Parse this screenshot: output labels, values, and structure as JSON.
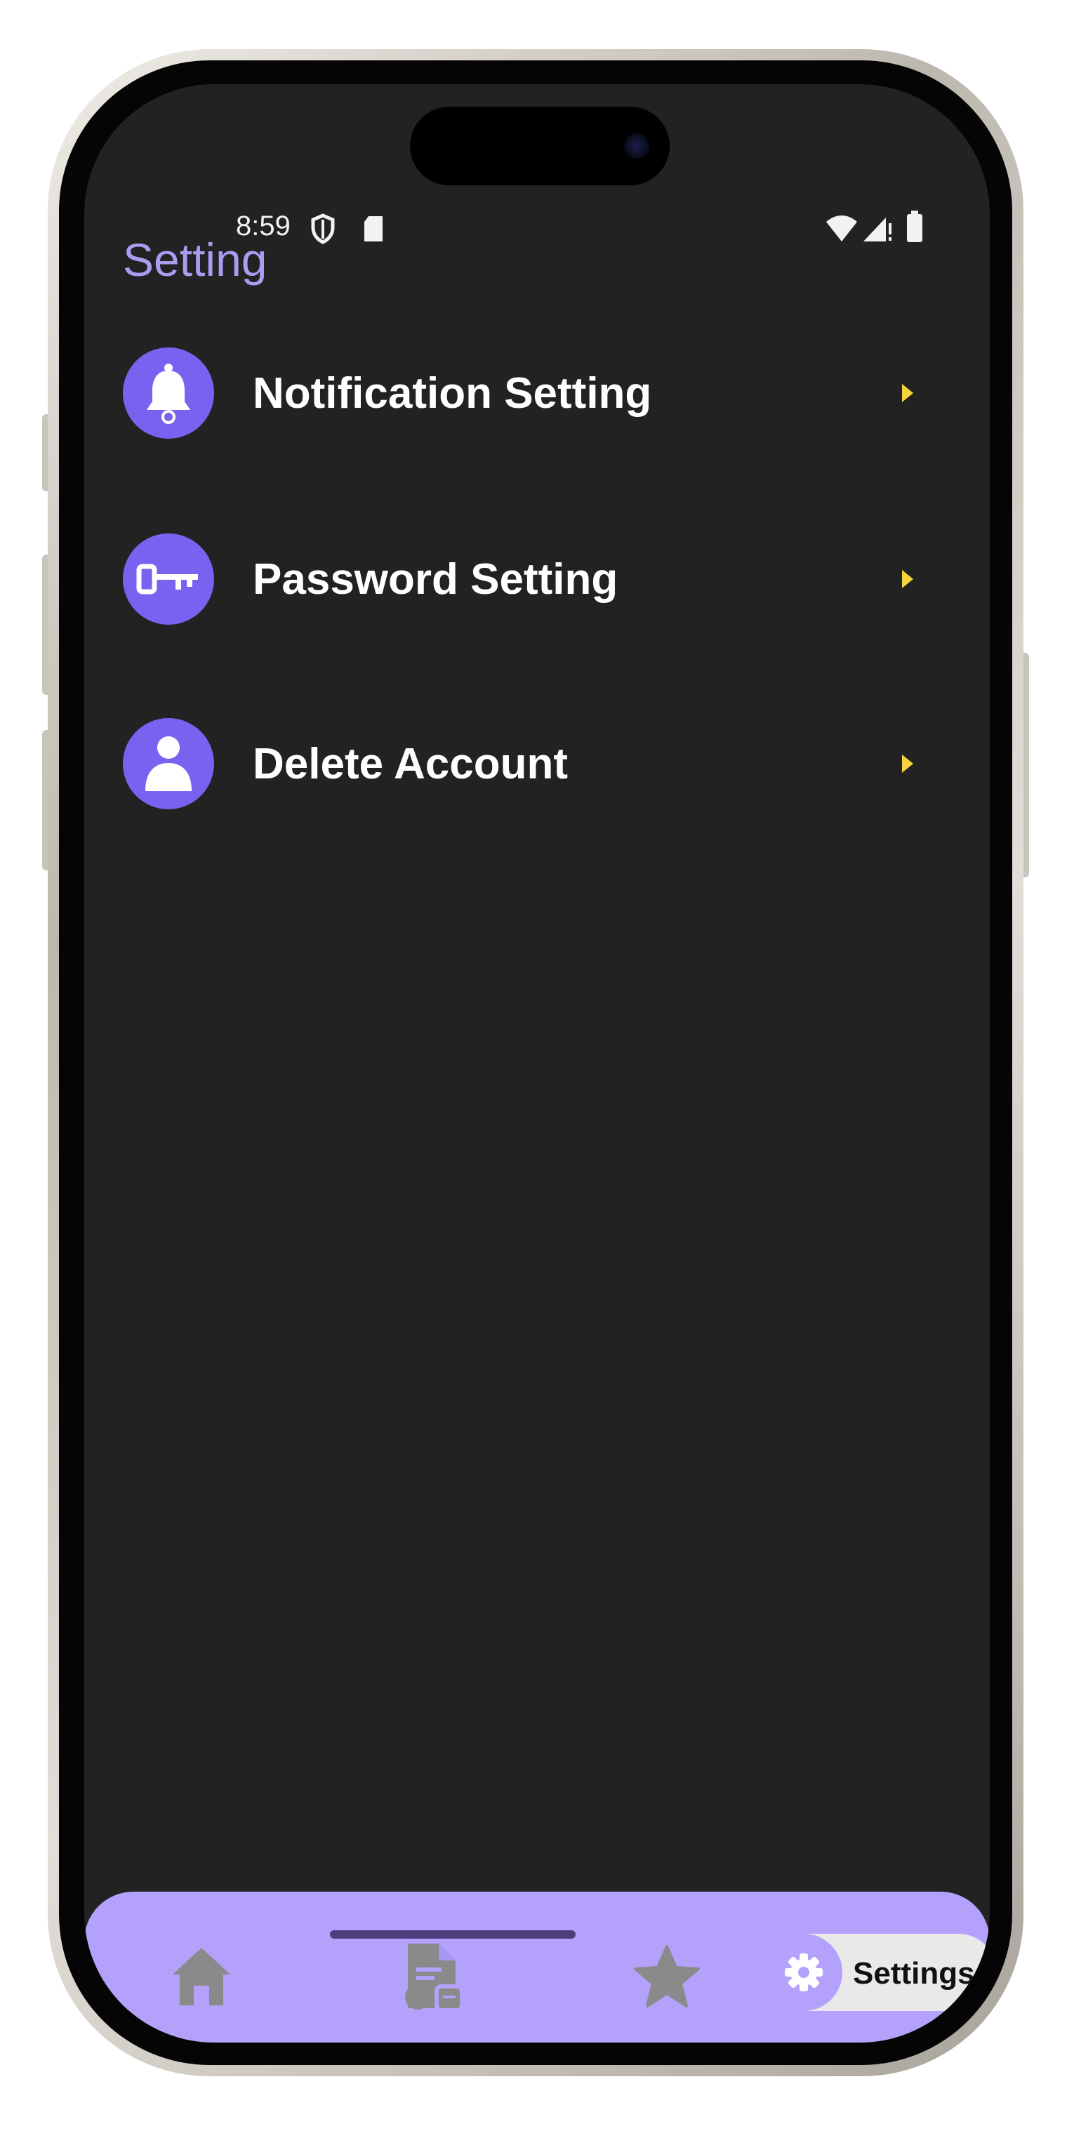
{
  "status_bar": {
    "time": "8:59",
    "icons": [
      "shield-icon",
      "sd-card-icon",
      "wifi-icon",
      "signal-icon",
      "battery-icon"
    ]
  },
  "page": {
    "title": "Setting"
  },
  "settings_items": [
    {
      "label": "Notification Setting",
      "icon": "bell-icon"
    },
    {
      "label": "Password Setting",
      "icon": "key-icon"
    },
    {
      "label": "Delete Account",
      "icon": "person-icon"
    }
  ],
  "bottom_nav": {
    "items": [
      {
        "icon": "home-icon"
      },
      {
        "icon": "document-icon"
      },
      {
        "icon": "star-icon"
      }
    ],
    "active": {
      "icon": "gear-icon",
      "label": "Settings"
    }
  },
  "colors": {
    "background": "#222222",
    "accent": "#7b61f0",
    "title": "#ad9bf2",
    "chevron": "#f5d43c",
    "nav_background": "#b3a1fb",
    "nav_icon_inactive": "#8a8a8a"
  }
}
